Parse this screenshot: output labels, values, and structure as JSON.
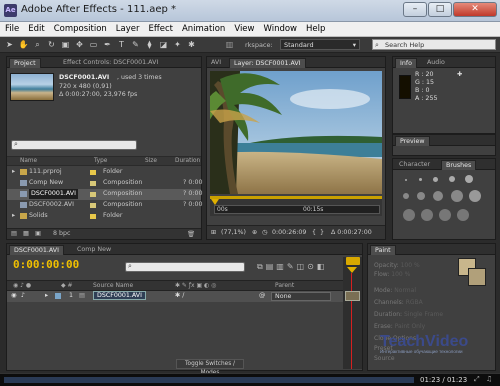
{
  "window": {
    "title": "Adobe After Effects - 111.aep *",
    "minimize": "–",
    "maximize": "□",
    "close": "✕"
  },
  "menu": [
    "File",
    "Edit",
    "Composition",
    "Layer",
    "Effect",
    "Animation",
    "View",
    "Window",
    "Help"
  ],
  "toolbar": {
    "workspace_label": "rkspace:",
    "workspace_value": "Standard",
    "search_placeholder": "Search Help"
  },
  "project": {
    "tabs": [
      "Project",
      "Effect Controls: DSCF0001.AVI"
    ],
    "item_name": "DSCF0001.AVI",
    "used_text": ", used 3 times",
    "dimensions": "720 x 480 (0,91)",
    "duration": "Δ 0:00:27:00, 23,976 fps",
    "columns": {
      "name": "Name",
      "type": "Type",
      "size": "Size",
      "duration": "Duration"
    },
    "rows": [
      {
        "name": "111.prproj",
        "type": "Folder",
        "size": "",
        "duration": "",
        "swatch": "#e8c84a"
      },
      {
        "name": "Comp New",
        "type": "Composition",
        "size": "",
        "duration": "? 0:00",
        "swatch": "#d8c878"
      },
      {
        "name": "DSCF0001.AVI",
        "type": "Composition",
        "size": "",
        "duration": "? 0:00",
        "swatch": "#d8c878"
      },
      {
        "name": "DSCF0002.AVI",
        "type": "Composition",
        "size": "",
        "duration": "? 0:00",
        "swatch": "#d8c878"
      },
      {
        "name": "Solids",
        "type": "Folder",
        "size": "",
        "duration": "",
        "swatch": "#e8c84a"
      }
    ],
    "bpc": "8 bpc"
  },
  "viewer": {
    "tabs": [
      "AVI",
      "Layer: DSCF0001.AVI"
    ],
    "time_start": "00s",
    "time_marker": "00:15s",
    "zoom": "(77,1%)",
    "current_time": "0:00:26:09",
    "frame_delta": "Δ 0:00:27:00"
  },
  "info": {
    "tabs": [
      "Info",
      "Audio"
    ],
    "r": "R : 20",
    "g": "G : 15",
    "b": "B : 0",
    "a": "A : 255"
  },
  "preview": {
    "tab": "Preview"
  },
  "character": {
    "tabs": [
      "Character",
      "Brushes"
    ]
  },
  "timeline": {
    "tabs": [
      "DSCF0001.AVI",
      "Comp New"
    ],
    "time": "0:00:00:00",
    "columns": {
      "source": "Source Name",
      "parent": "Parent"
    },
    "row": {
      "index": "1",
      "name": "DSCF0001.AVI",
      "parent": "None"
    },
    "toggle": "Toggle Switches / Modes"
  },
  "paint": {
    "tab": "Paint",
    "opacity": "100 %",
    "flow": "100 %",
    "mode": "Normal",
    "channels": "RGBA",
    "duration": "Single Frame",
    "erase": "Paint Only",
    "clone_options": "Clone Options",
    "preset": "Preset",
    "source": "Source",
    "swatch": "#c8b68c"
  },
  "watermark": {
    "line1": "Интерактивные обучающие",
    "line2": "Интерактивные обучающие технологии"
  },
  "status": {
    "time": "01:23 / 01:23"
  }
}
